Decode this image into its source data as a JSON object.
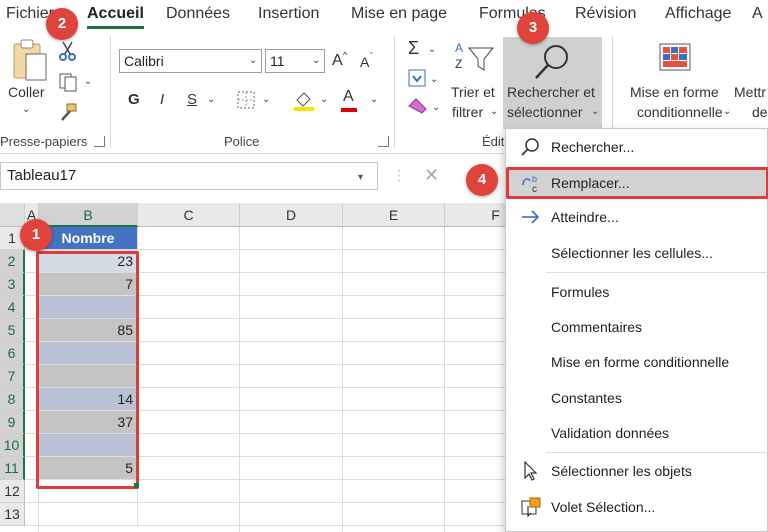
{
  "tabs": [
    {
      "label": "Fichier",
      "active": false
    },
    {
      "label": "Accueil",
      "active": true
    },
    {
      "label": "Données",
      "active": false
    },
    {
      "label": "Insertion",
      "active": false
    },
    {
      "label": "Mise en page",
      "active": false
    },
    {
      "label": "Formules",
      "active": false
    },
    {
      "label": "Révision",
      "active": false
    },
    {
      "label": "Affichage",
      "active": false
    },
    {
      "label": "A",
      "active": false
    }
  ],
  "ribbon": {
    "clipboard": {
      "paste_label": "Coller",
      "group_label": "Presse-papiers"
    },
    "font": {
      "font_name": "Calibri",
      "font_size": "11",
      "group_label": "Police",
      "bold": "G",
      "italic": "I",
      "underline": "S",
      "grow": "A",
      "shrink": "A",
      "font_color": "A"
    },
    "editing": {
      "sort_label_1": "Trier et",
      "sort_label_2": "filtrer",
      "find_label_1": "Rechercher et",
      "find_label_2": "sélectionner",
      "group_label": "Édit"
    },
    "styles": {
      "cond_label_1": "Mise en forme",
      "cond_label_2": "conditionnelle",
      "next_label_1": "Mettr",
      "next_label_2": "de"
    }
  },
  "formula_bar": {
    "name_box": "Tableau17"
  },
  "grid": {
    "columns": [
      "A",
      "B",
      "C",
      "D",
      "E",
      "F"
    ],
    "rows": [
      "1",
      "2",
      "3",
      "4",
      "5",
      "6",
      "7",
      "8",
      "9",
      "10",
      "11",
      "12",
      "13"
    ],
    "header_cell": "Nombre",
    "values": [
      "23",
      "7",
      "",
      "85",
      "",
      "",
      "14",
      "37",
      "",
      "5"
    ]
  },
  "menu": {
    "items": [
      {
        "label": "Rechercher...",
        "icon": "search-icon"
      },
      {
        "label": "Remplacer...",
        "icon": "replace-icon"
      },
      {
        "label": "Atteindre...",
        "icon": "arrow-right-icon"
      },
      {
        "label": "Sélectionner les cellules...",
        "icon": ""
      },
      {
        "label": "Formules",
        "icon": ""
      },
      {
        "label": "Commentaires",
        "icon": ""
      },
      {
        "label": "Mise en forme conditionnelle",
        "icon": ""
      },
      {
        "label": "Constantes",
        "icon": ""
      },
      {
        "label": "Validation données",
        "icon": ""
      },
      {
        "label": "Sélectionner les objets",
        "icon": "cursor-icon"
      },
      {
        "label": "Volet Sélection...",
        "icon": "selection-pane-icon"
      }
    ]
  },
  "badges": [
    "1",
    "2",
    "3",
    "4"
  ],
  "colors": {
    "accent": "#217346",
    "badge": "#e0433b",
    "table_header": "#4472c4",
    "highlight_box": "#e03c3c"
  }
}
